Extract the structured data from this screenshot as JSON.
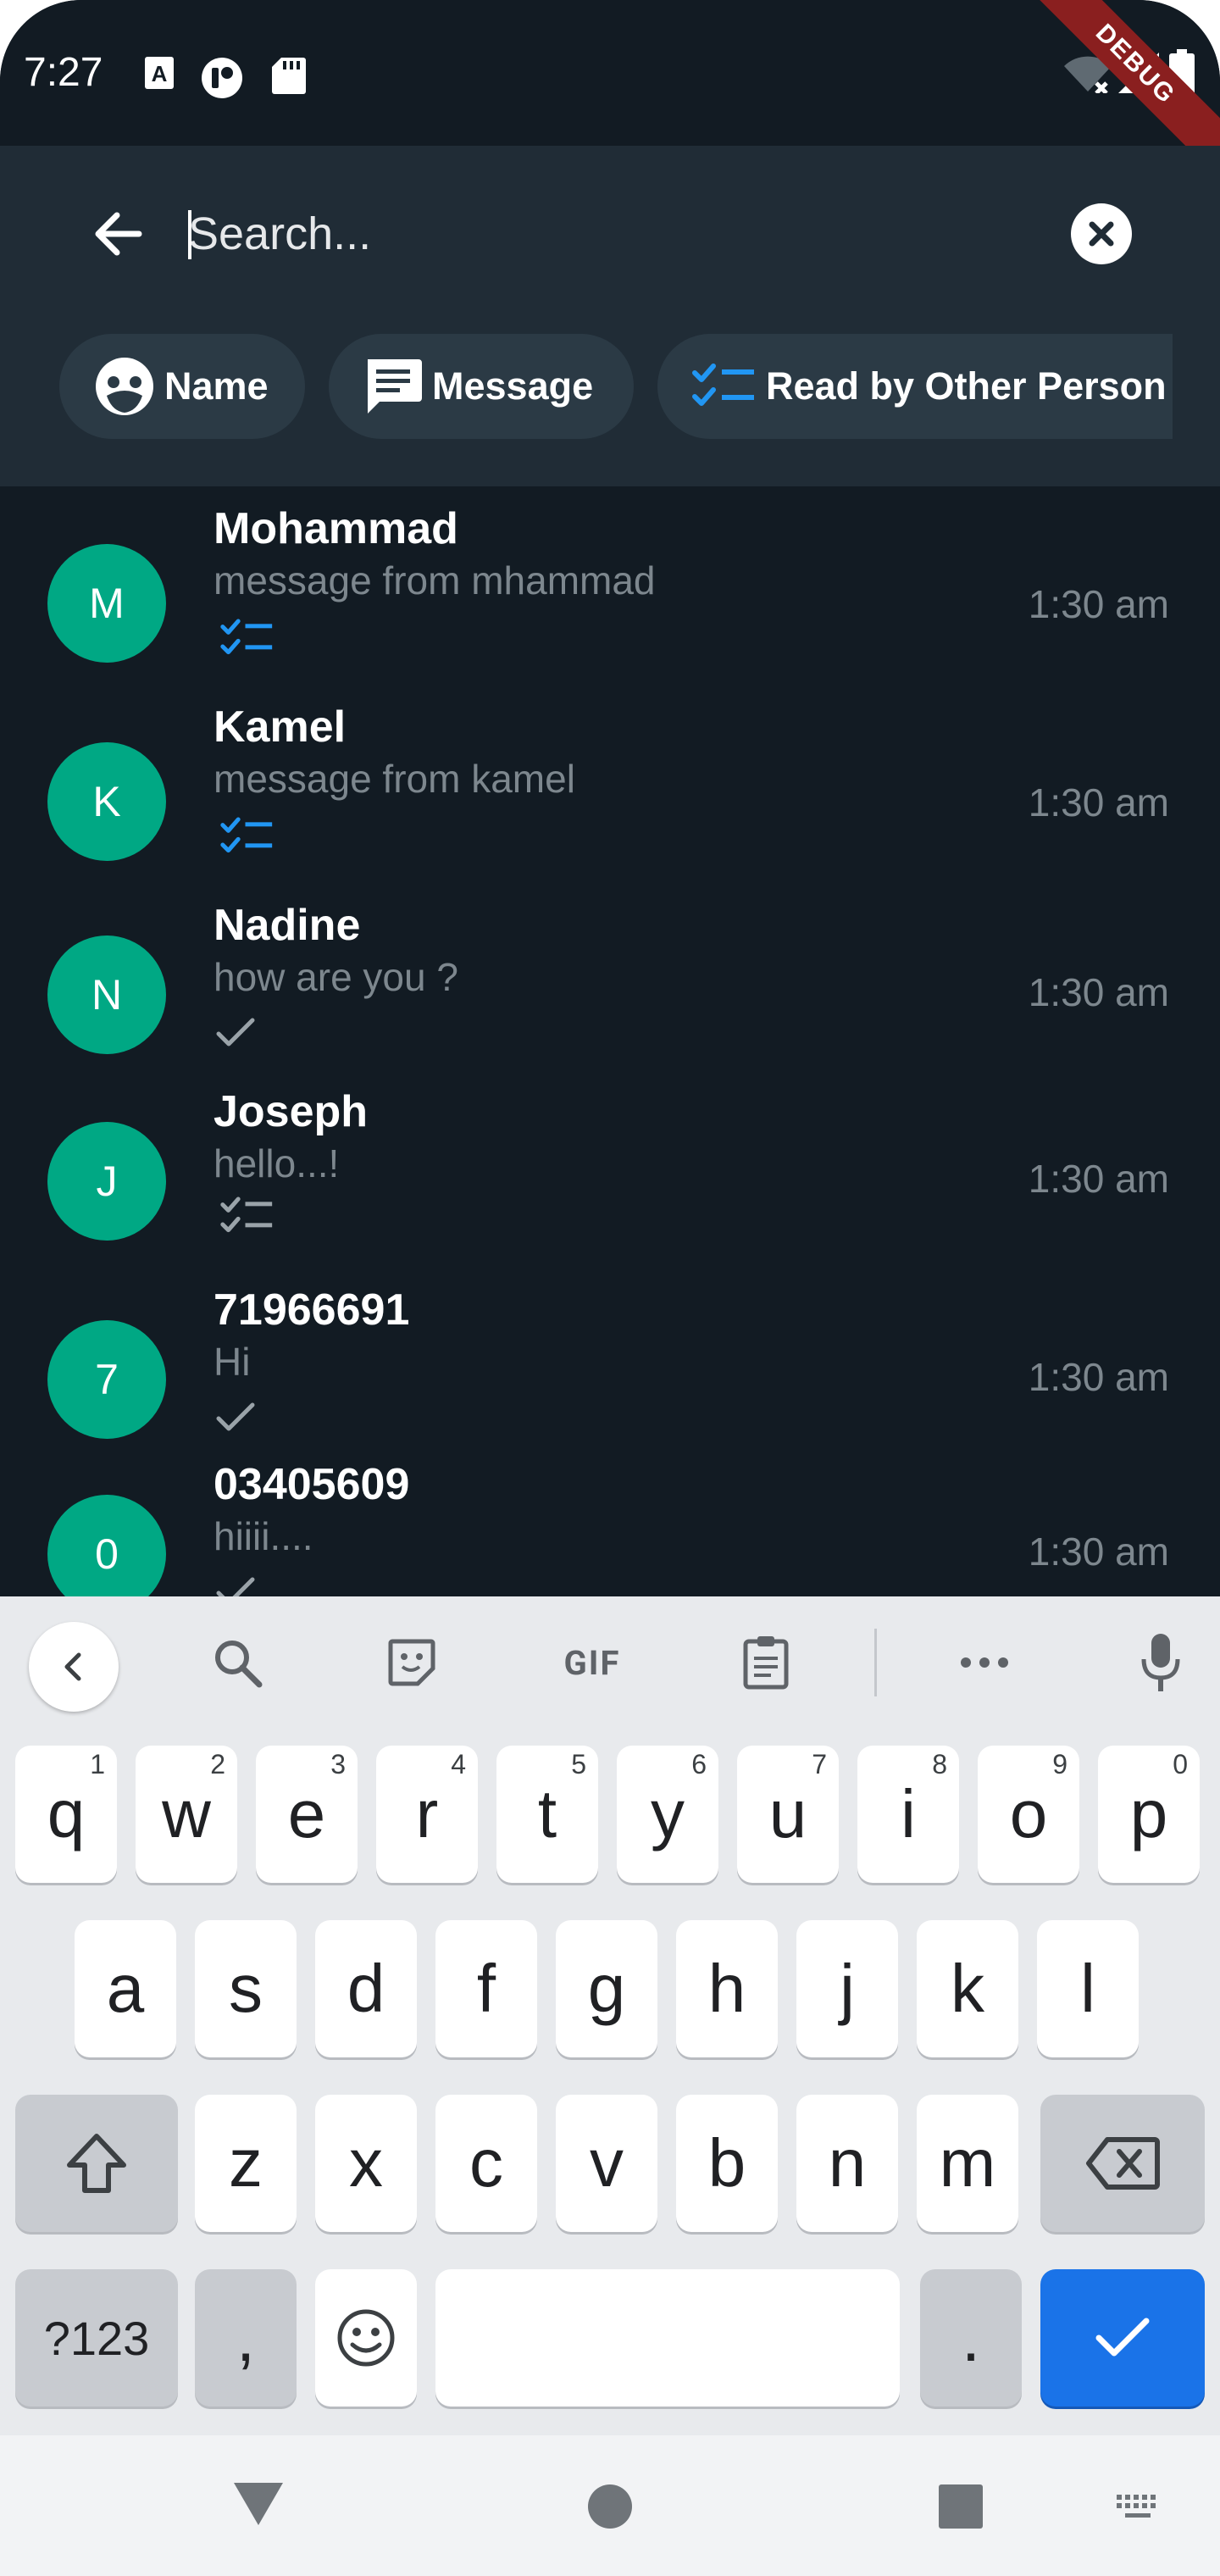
{
  "status_bar": {
    "time": "7:27",
    "icons": [
      "accessibility-a-icon",
      "media-icon",
      "sd-card-icon",
      "wifi-off-icon",
      "signal-icon",
      "battery-icon"
    ],
    "debug_banner": "DEBUG"
  },
  "search": {
    "placeholder": "Search...",
    "value": ""
  },
  "filters": [
    {
      "label": "Name",
      "icon": "face-icon"
    },
    {
      "label": "Message",
      "icon": "message-icon"
    },
    {
      "label": "Read by Other Person",
      "icon": "checklist-icon"
    }
  ],
  "chats": [
    {
      "initial": "M",
      "name": "Mohammad",
      "message": "message from mhammad",
      "time": "1:30 am",
      "status": "read-blue"
    },
    {
      "initial": "K",
      "name": "Kamel",
      "message": "message from kamel",
      "time": "1:30 am",
      "status": "read-blue"
    },
    {
      "initial": "N",
      "name": "Nadine",
      "message": "how are you ?",
      "time": "1:30 am",
      "status": "sent"
    },
    {
      "initial": "J",
      "name": "Joseph",
      "message": "hello...!",
      "time": "1:30 am",
      "status": "read-grey"
    },
    {
      "initial": "7",
      "name": "71966691",
      "message": "Hi",
      "time": "1:30 am",
      "status": "sent"
    },
    {
      "initial": "0",
      "name": "03405609",
      "message": "hiiii....",
      "time": "1:30 am",
      "status": "sent"
    }
  ],
  "keyboard": {
    "toolbar": [
      "back-icon",
      "search-icon",
      "sticker-icon",
      "GIF",
      "clipboard-icon",
      "more-icon",
      "mic-icon"
    ],
    "gif_label": "GIF",
    "row1": [
      {
        "key": "q",
        "hint": "1"
      },
      {
        "key": "w",
        "hint": "2"
      },
      {
        "key": "e",
        "hint": "3"
      },
      {
        "key": "r",
        "hint": "4"
      },
      {
        "key": "t",
        "hint": "5"
      },
      {
        "key": "y",
        "hint": "6"
      },
      {
        "key": "u",
        "hint": "7"
      },
      {
        "key": "i",
        "hint": "8"
      },
      {
        "key": "o",
        "hint": "9"
      },
      {
        "key": "p",
        "hint": "0"
      }
    ],
    "row2": [
      "a",
      "s",
      "d",
      "f",
      "g",
      "h",
      "j",
      "k",
      "l"
    ],
    "row3": [
      "z",
      "x",
      "c",
      "v",
      "b",
      "n",
      "m"
    ],
    "symbols_label": "?123",
    "comma_label": ",",
    "period_label": "."
  },
  "colors": {
    "background": "#121b23",
    "header": "#202c36",
    "chip": "#2b3a45",
    "avatar": "#00a884",
    "accent_blue": "#2196f3",
    "enter_key": "#1a73e8"
  }
}
